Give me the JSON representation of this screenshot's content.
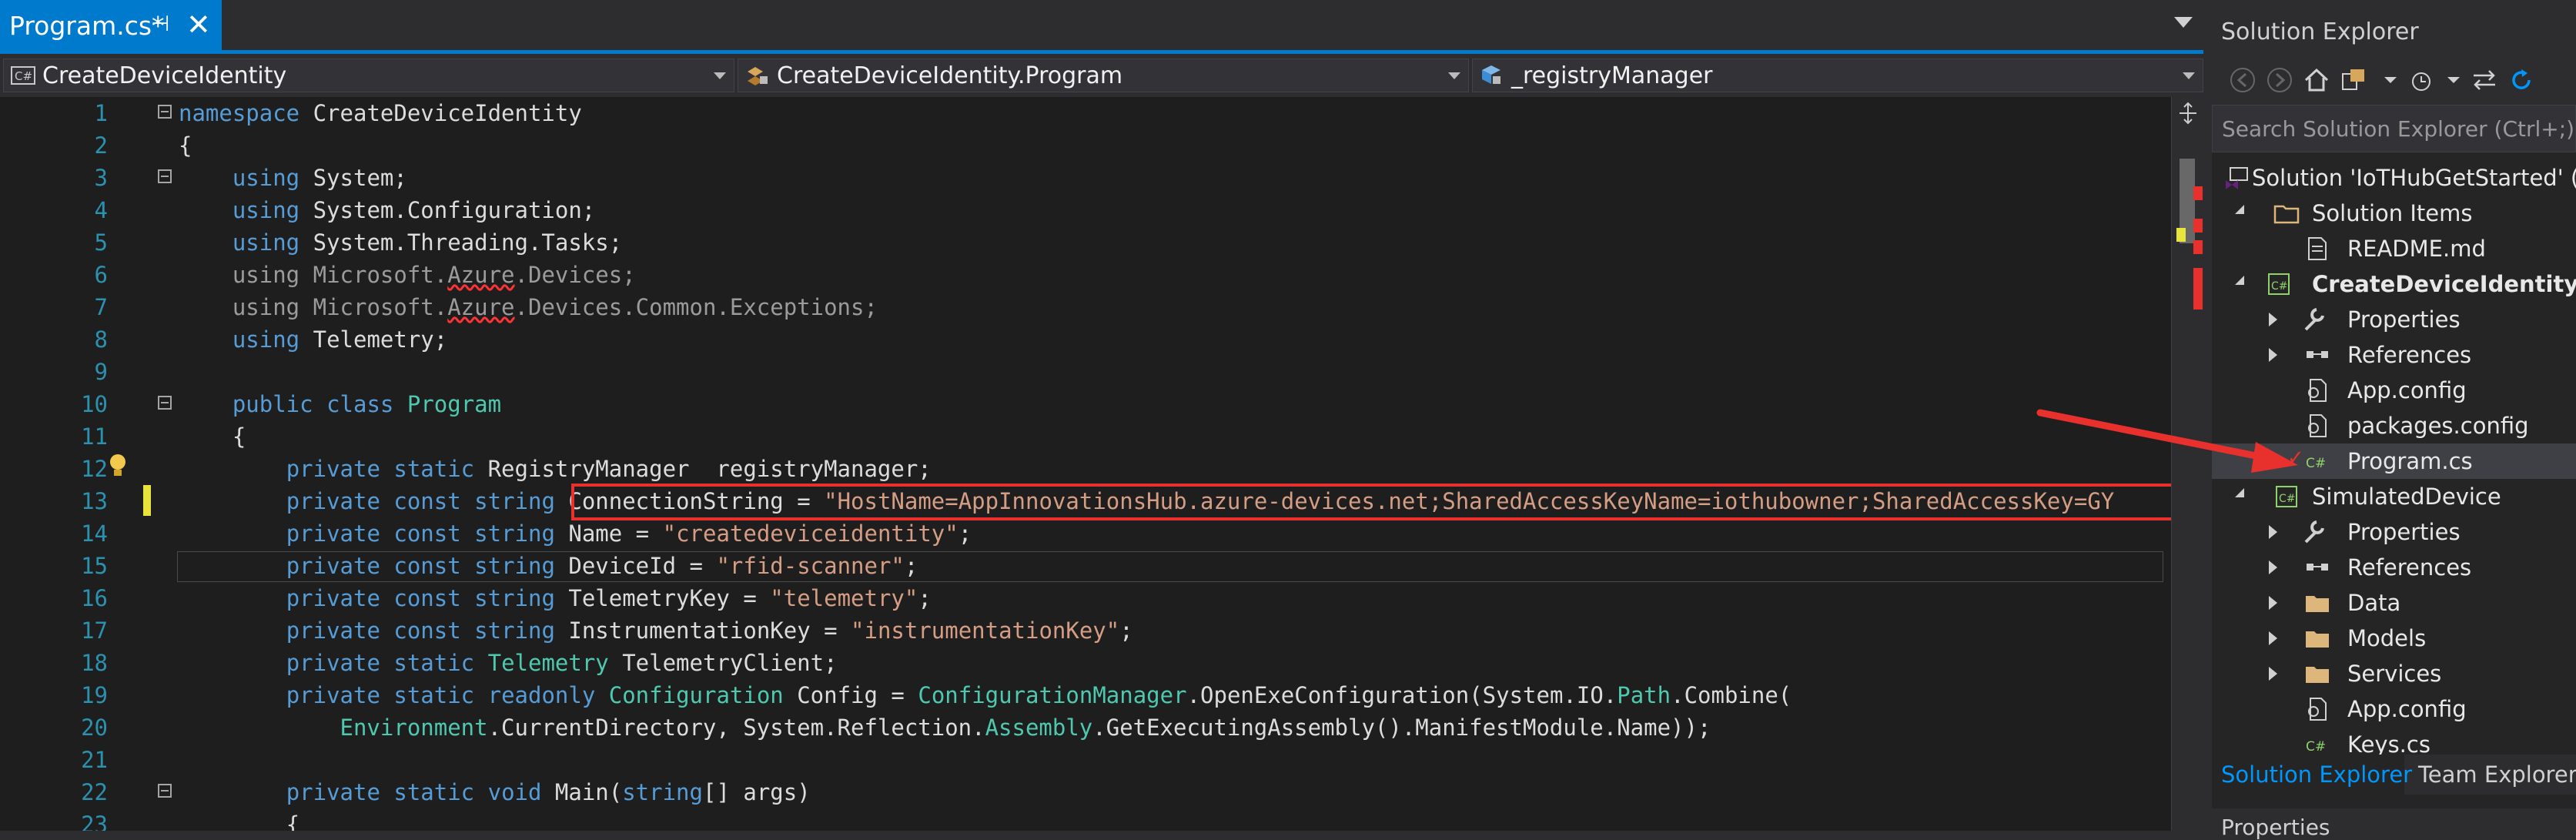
{
  "document_tab": {
    "label": "Program.cs*",
    "pin_glyph": "⊣",
    "close_glyph": "✕"
  },
  "navigation_bar": {
    "project": "CreateDeviceIdentity",
    "type": "CreateDeviceIdentity.Program",
    "member": "_registryManager"
  },
  "code_lines": [
    {
      "n": "1"
    },
    {
      "n": "2"
    },
    {
      "n": "3"
    },
    {
      "n": "4"
    },
    {
      "n": "5"
    },
    {
      "n": "6"
    },
    {
      "n": "7"
    },
    {
      "n": "8"
    },
    {
      "n": "9"
    },
    {
      "n": "10"
    },
    {
      "n": "11"
    },
    {
      "n": "12"
    },
    {
      "n": "13"
    },
    {
      "n": "14"
    },
    {
      "n": "15"
    },
    {
      "n": "16"
    },
    {
      "n": "17"
    },
    {
      "n": "18"
    },
    {
      "n": "19"
    },
    {
      "n": "20"
    },
    {
      "n": "21"
    },
    {
      "n": "22"
    },
    {
      "n": "23"
    }
  ],
  "code_text": {
    "l1": [
      "namespace",
      " CreateDeviceIdentity"
    ],
    "l2": "{",
    "l3": [
      "using",
      " System;"
    ],
    "l4": [
      "using",
      " System.Configuration;"
    ],
    "l5": [
      "using",
      " System.Threading.Tasks;"
    ],
    "l6": [
      "using",
      " Microsoft.",
      "Azure",
      ".Devices;"
    ],
    "l7": [
      "using",
      " Microsoft.",
      "Azure",
      ".Devices.Common.Exceptions;"
    ],
    "l8": [
      "using",
      " Telemetry;"
    ],
    "l10": [
      "public",
      " ",
      "class",
      " ",
      "Program"
    ],
    "l11": "{",
    "l12": [
      "private",
      " ",
      "static",
      " RegistryManager  registryManager;"
    ],
    "l13": [
      "private",
      " ",
      "const",
      " ",
      "string",
      " ConnectionString = ",
      "\"HostName=AppInnovationsHub.azure-devices.net;SharedAccessKeyName=iothubowner;SharedAccessKey=GY"
    ],
    "l14": [
      "private",
      " ",
      "const",
      " ",
      "string",
      " Name = ",
      "\"createdeviceidentity\"",
      ";"
    ],
    "l15": [
      "private",
      " ",
      "const",
      " ",
      "string",
      " DeviceId = ",
      "\"rfid-scanner\"",
      ";"
    ],
    "l16": [
      "private",
      " ",
      "const",
      " ",
      "string",
      " TelemetryKey = ",
      "\"telemetry\"",
      ";"
    ],
    "l17": [
      "private",
      " ",
      "const",
      " ",
      "string",
      " InstrumentationKey = ",
      "\"instrumentationKey\"",
      ";"
    ],
    "l18": [
      "private",
      " ",
      "static",
      " ",
      "Telemetry",
      " TelemetryClient;"
    ],
    "l19": [
      "private",
      " ",
      "static",
      " ",
      "readonly",
      " ",
      "Configuration",
      " Config = ",
      "ConfigurationManager",
      ".OpenExeConfiguration(System.IO.",
      "Path",
      ".Combine("
    ],
    "l20": [
      "Environment",
      ".CurrentDirectory, System.Reflection.",
      "Assembly",
      ".GetExecutingAssembly().ManifestModule.Name));"
    ],
    "l22": [
      "private",
      " ",
      "static",
      " ",
      "void",
      " Main(",
      "string",
      "[] args)"
    ],
    "l23": "{"
  },
  "solution_explorer": {
    "title": "Solution Explorer",
    "search_placeholder": "Search Solution Explorer (Ctrl+;)",
    "items": [
      {
        "label": "Solution 'IoTHubGetStarted' (",
        "icon": "solution-icon"
      },
      {
        "label": "Solution Items",
        "icon": "folder-icon"
      },
      {
        "label": "README.md",
        "icon": "file-icon"
      },
      {
        "label": "CreateDeviceIdentity",
        "icon": "csharp-project-icon"
      },
      {
        "label": "Properties",
        "icon": "wrench-icon"
      },
      {
        "label": "References",
        "icon": "references-icon"
      },
      {
        "label": "App.config",
        "icon": "config-icon"
      },
      {
        "label": "packages.config",
        "icon": "config-icon"
      },
      {
        "label": "Program.cs",
        "icon": "csharp-file-icon"
      },
      {
        "label": "SimulatedDevice",
        "icon": "csharp-project-icon"
      },
      {
        "label": "Properties",
        "icon": "wrench-icon"
      },
      {
        "label": "References",
        "icon": "references-icon"
      },
      {
        "label": "Data",
        "icon": "folder-icon"
      },
      {
        "label": "Models",
        "icon": "folder-icon"
      },
      {
        "label": "Services",
        "icon": "folder-icon"
      },
      {
        "label": "App.config",
        "icon": "config-icon"
      },
      {
        "label": "Keys.cs",
        "icon": "csharp-file-icon"
      }
    ],
    "tabs": [
      "Solution Explorer",
      "Team Explorer"
    ],
    "properties_header": "Properties"
  },
  "colors": {
    "accent": "#007acc",
    "keyword": "#569cd6",
    "type": "#4ec9b0",
    "string": "#d69d85",
    "line_number": "#2b91af",
    "highlight_box": "#e8302c"
  }
}
